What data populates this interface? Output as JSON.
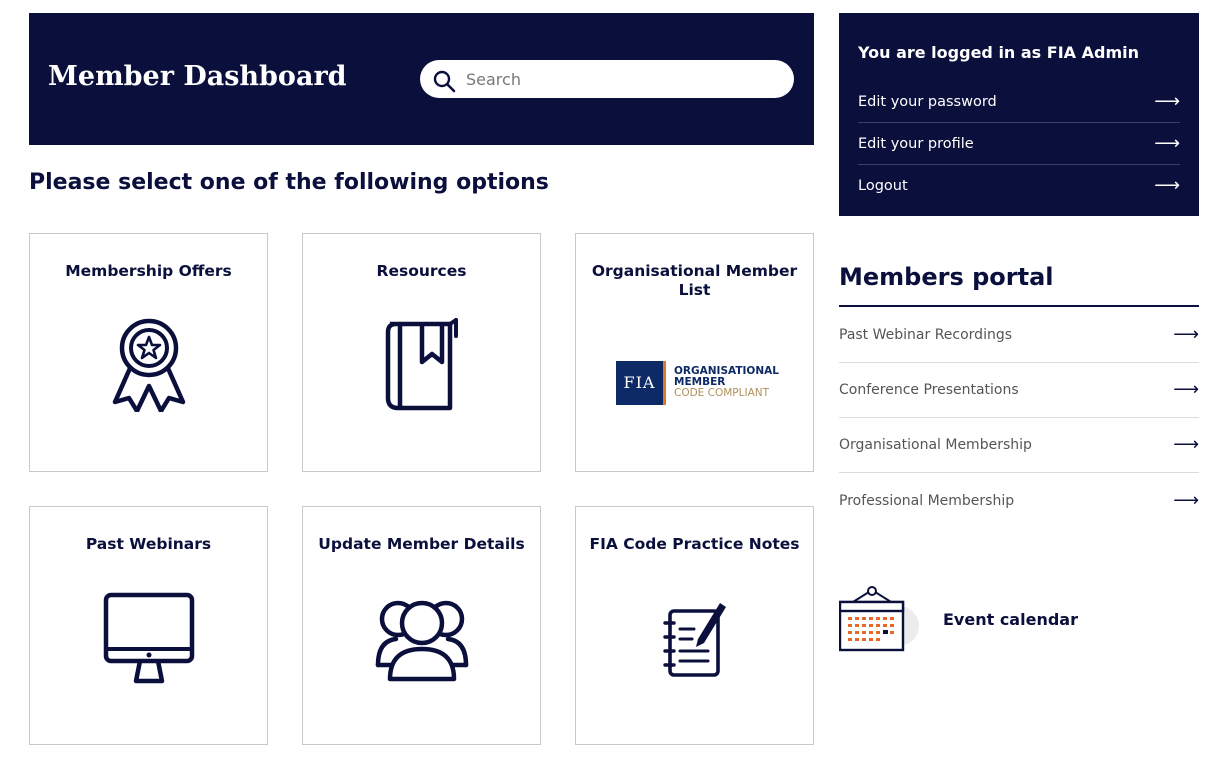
{
  "hero": {
    "title": "Member Dashboard",
    "search_placeholder": "Search"
  },
  "prompt": "Please select one of the following options",
  "tiles": [
    {
      "label": "Membership Offers",
      "icon": "award-ribbon-icon"
    },
    {
      "label": "Resources",
      "icon": "book-bookmark-icon"
    },
    {
      "label": "Organisational Member List",
      "icon": "fia-logo"
    },
    {
      "label": "Past Webinars",
      "icon": "monitor-icon"
    },
    {
      "label": "Update Member Details",
      "icon": "users-group-icon"
    },
    {
      "label": "FIA Code Practice Notes",
      "icon": "notepad-pen-icon"
    }
  ],
  "fia_logo": {
    "mark": "FIA",
    "line1": "ORGANISATIONAL",
    "line2": "MEMBER",
    "line3": "CODE COMPLIANT"
  },
  "account": {
    "title": "You are logged in as FIA Admin",
    "links": [
      "Edit your password",
      "Edit your profile",
      "Logout"
    ]
  },
  "portal": {
    "title": "Members portal",
    "links": [
      "Past Webinar Recordings",
      "Conference Presentations",
      "Organisational Membership",
      "Professional Membership"
    ]
  },
  "event": {
    "label": "Event calendar"
  },
  "arrow_glyph": "⟶",
  "colors": {
    "navy": "#0a0f3c",
    "fia_blue": "#0d2a66",
    "fia_orange": "#e0782a",
    "fia_gold": "#b0915a",
    "calendar_orange": "#e8672a"
  }
}
